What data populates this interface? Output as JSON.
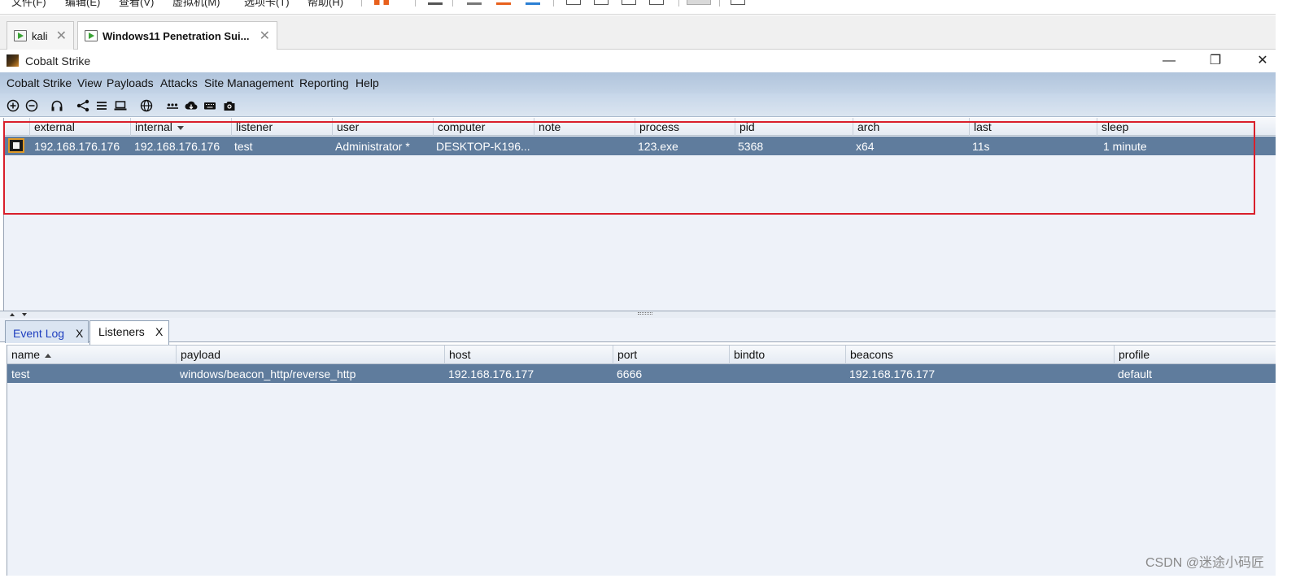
{
  "vmware": {
    "menu": [
      "文件(F)",
      "编辑(E)",
      "查看(V)",
      "虚拟机(M)",
      "选项卡(T)",
      "帮助(H)"
    ],
    "tabs": [
      {
        "label": "kali",
        "active": false
      },
      {
        "label": "Windows11 Penetration Sui...",
        "active": true
      }
    ],
    "tab_close": "✕"
  },
  "app": {
    "title": "Cobalt Strike",
    "window_controls": {
      "minimize": "—",
      "restore": "❐",
      "close": "✕"
    },
    "menu": [
      "Cobalt Strike",
      "View",
      "Payloads",
      "Attacks",
      "Site Management",
      "Reporting",
      "Help"
    ],
    "toolbar_icons": [
      "new-connection-icon",
      "disconnect-icon",
      "listeners-icon",
      "pivot-graph-icon",
      "sessions-table-icon",
      "targets-icon",
      "web-log-icon",
      "credentials-icon",
      "downloads-icon",
      "keystrokes-icon",
      "screenshots-icon"
    ]
  },
  "beacons": {
    "columns": [
      "external",
      "internal",
      "listener",
      "user",
      "computer",
      "note",
      "process",
      "pid",
      "arch",
      "last",
      "sleep"
    ],
    "sorted_column": "internal",
    "rows": [
      {
        "external": "192.168.176.176",
        "internal": "192.168.176.176",
        "listener": "test",
        "user": "Administrator *",
        "computer": "DESKTOP-K196...",
        "note": "",
        "process": "123.exe",
        "pid": "5368",
        "arch": "x64",
        "last": "11s",
        "sleep": "1 minute"
      }
    ]
  },
  "bottom_tabs": [
    {
      "label": "Event Log",
      "close": "X",
      "active": false
    },
    {
      "label": "Listeners",
      "close": "X",
      "active": true
    }
  ],
  "listeners": {
    "columns": [
      "name",
      "payload",
      "host",
      "port",
      "bindto",
      "beacons",
      "profile"
    ],
    "sorted_column": "name",
    "rows": [
      {
        "name": "test",
        "payload": "windows/beacon_http/reverse_http",
        "host": "192.168.176.177",
        "port": "6666",
        "bindto": "",
        "beacons": "192.168.176.177",
        "profile": "default"
      }
    ]
  },
  "watermark": "CSDN @迷途小码匠",
  "colors": {
    "selected_row": "#5f7c9d",
    "highlight_box": "#d91f2b",
    "menubar": "#b0c4dc",
    "event_log_tab_text": "#1f3fbf"
  }
}
